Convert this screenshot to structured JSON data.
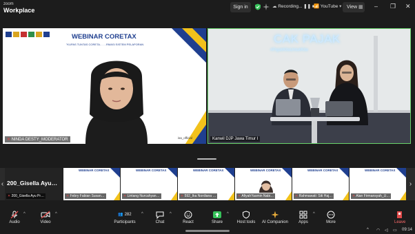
{
  "app": {
    "line1": "zoom",
    "line2": "Workplace"
  },
  "titlebar": {
    "sign_in": "Sign in",
    "recording": "Recording...",
    "youtube": "YouTube",
    "view": "View",
    "minimize": "–",
    "maximize": "❐",
    "close": "✕"
  },
  "main": {
    "tile1": {
      "banner_title": "WEBINAR CORETAX",
      "banner_sub": "\"KUPAS TUNTAS CORETA…           …RMASI SISTEM PELAPORAN",
      "watermark": "isa_official",
      "name": "NINDA DESTY_MODERATOR"
    },
    "tile2": {
      "cak_pajak": "CAK PAJAK",
      "hashtag": "#PajakKitaUntukKita",
      "name": "Kanwil DJP Jawa Timur I"
    }
  },
  "gallery": {
    "first": {
      "big": "200_Gisella  Ayu…",
      "name": "200_Gisella Ayu Pr…"
    },
    "banner_title": "WEBINAR CORETAX",
    "tiles": [
      {
        "name": "Febry Fabian Susan…"
      },
      {
        "name": "Lintang Nurcahyan…"
      },
      {
        "name": "592_Ika Nordiana …"
      },
      {
        "name": "AfiyahYasmin Nabi…"
      },
      {
        "name": "Rahmawati: Siti Haj…"
      },
      {
        "name": "Alan Firmansyah_U…"
      }
    ],
    "prev": "‹",
    "next": "›"
  },
  "toolbar": {
    "audio": "Audio",
    "video": "Video",
    "participants": "Participants",
    "participants_count": "282",
    "chat": "Chat",
    "react": "React",
    "share": "Share",
    "host_tools": "Host tools",
    "ai_companion": "AI Companion",
    "apps": "Apps",
    "more": "More",
    "leave": "Leave"
  },
  "system": {
    "time": "09:14"
  },
  "colors": {
    "accent_green": "#69d36b",
    "coretax_blue": "#1f3f8f",
    "leave_red": "#e04a4a"
  }
}
